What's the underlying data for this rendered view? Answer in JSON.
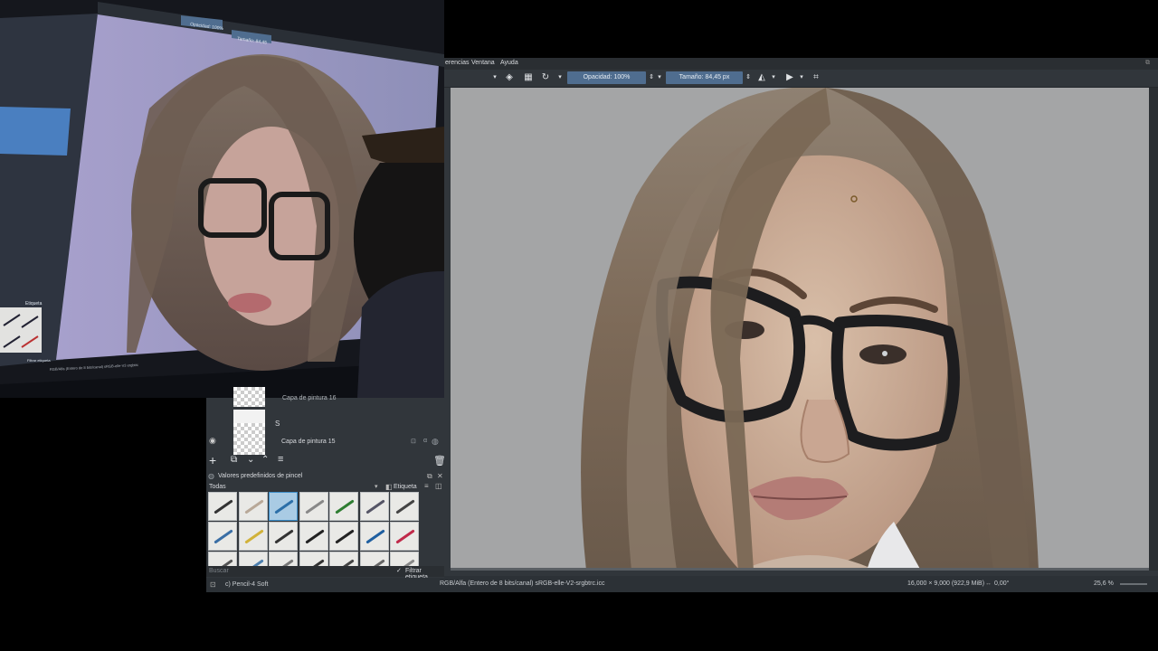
{
  "menubar": {
    "items": [
      "erencias",
      "Ventana",
      "Ayuda"
    ]
  },
  "toolbar": {
    "opacity_label": "Opacidad: 100%",
    "size_label": "Tamaño: 84,45 px"
  },
  "status_right": {
    "color_space": "RGB/Alfa (Entero de 8 bits/canal)  sRGB-elle-V2-srgbtrc.icc",
    "dimensions": "16,000 × 9,000 (922,9 MiB)",
    "rotation": "0,00°",
    "zoom": "25,6 %"
  },
  "layers": {
    "partial_label": "Capa de pintura 16",
    "row_letter": "S",
    "layer_name": "Capa de pintura 15"
  },
  "brush_presets": {
    "title": "Valores predefinidos de pincel",
    "filter_all": "Todas",
    "tag_label": "Etiqueta",
    "search_placeholder": "Buscar",
    "filter_tag": "Filtrar etiqueta",
    "current_brush": "c) Pencil-4 Soft"
  },
  "camera": {
    "screen_opacity": "Opacidad: 100%",
    "screen_size": "Tamaño: 84,45",
    "screen_tag": "Etiqueta",
    "screen_filter": "Filtrar etiqueta",
    "screen_status": "RGB/Alfa (Entero de 8 bits/canal)  sRGB-elle-V2-srgbtrc"
  },
  "colors": {
    "accent": "#4f6d8f",
    "panel": "#31363b",
    "canvas_bg": "#a4a5a6",
    "hair": "#7a6a5a"
  },
  "icons": [
    "eraser-icon",
    "alpha-lock-icon",
    "reset-icon",
    "mirror-icon",
    "wrap-icon",
    "crop-icon",
    "eye-icon",
    "add-icon",
    "trash-icon"
  ]
}
